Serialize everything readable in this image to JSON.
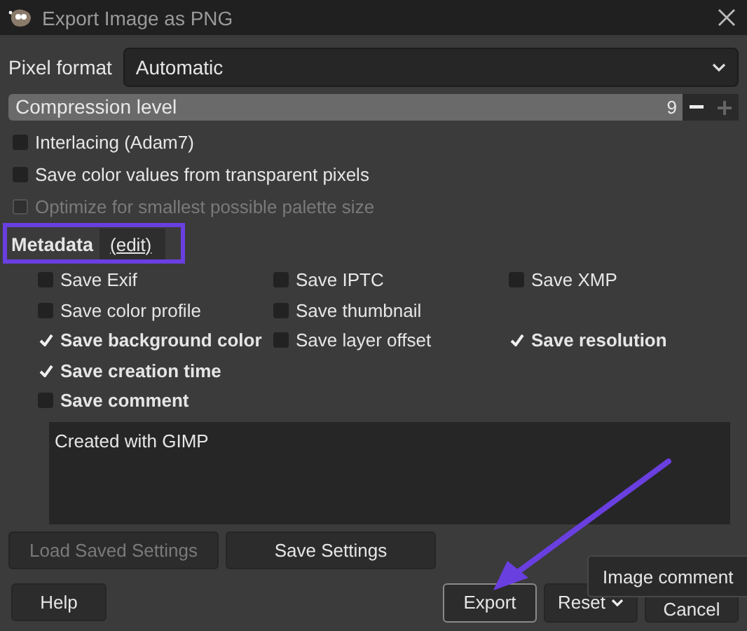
{
  "window": {
    "title": "Export Image as PNG"
  },
  "pixel_format": {
    "label": "Pixel format",
    "value": "Automatic"
  },
  "compression": {
    "label": "Compression level",
    "value": "9",
    "level": 1
  },
  "options": [
    {
      "label": "Interlacing (Adam7)",
      "checked": false,
      "disabled": false
    },
    {
      "label": "Save color values from transparent pixels",
      "checked": false,
      "disabled": false
    },
    {
      "label": "Optimize for smallest possible palette size",
      "checked": false,
      "disabled": true
    }
  ],
  "metadata": {
    "label": "Metadata",
    "edit_link": "(edit)"
  },
  "metadata_rows": [
    [
      {
        "label": "Save Exif",
        "checked": false,
        "modified": false
      },
      {
        "label": "Save IPTC",
        "checked": false,
        "modified": false
      },
      {
        "label": "Save XMP",
        "checked": false,
        "modified": false
      }
    ],
    [
      {
        "label": "Save color profile",
        "checked": false,
        "modified": false
      },
      {
        "label": "Save thumbnail",
        "checked": false,
        "modified": false
      }
    ],
    [
      {
        "label": "Save background color",
        "checked": true,
        "modified": true
      },
      {
        "label": "Save layer offset",
        "checked": false,
        "modified": false
      },
      {
        "label": "Save resolution",
        "checked": true,
        "modified": true
      }
    ],
    [
      {
        "label": "Save creation time",
        "checked": true,
        "modified": true
      }
    ],
    [
      {
        "label": "Save comment",
        "checked": false,
        "modified": true
      }
    ]
  ],
  "comment": {
    "value": "Created with GIMP"
  },
  "settings_buttons": [
    {
      "label": "Load Saved Settings",
      "disabled": true
    },
    {
      "label": "Save Settings",
      "disabled": false
    }
  ],
  "help_button": "Help",
  "action_buttons": [
    {
      "label": "Export",
      "kind": "default"
    },
    {
      "label": "Reset",
      "kind": "menu"
    },
    {
      "label": "Cancel",
      "kind": "plain"
    }
  ],
  "tooltip": "Image comment"
}
